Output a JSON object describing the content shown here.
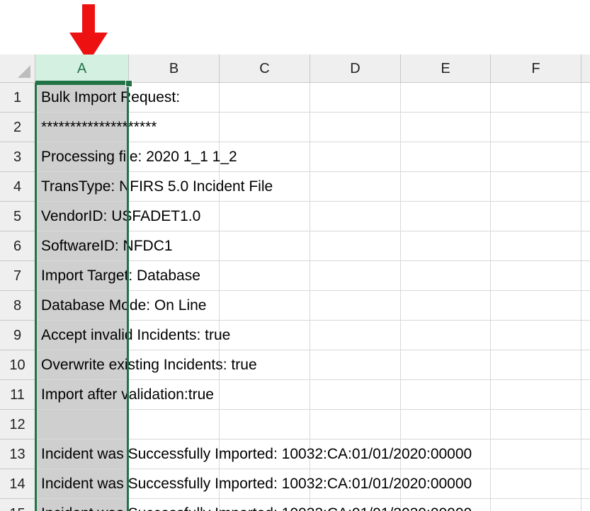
{
  "column_headers": [
    "A",
    "B",
    "C",
    "D",
    "E",
    "F"
  ],
  "selected_column": "A",
  "rows": [
    {
      "num": "1",
      "text": "Bulk Import Request:"
    },
    {
      "num": "2",
      "text": "********************"
    },
    {
      "num": "3",
      "text": "Processing file: 2020 1_1 1_2"
    },
    {
      "num": "4",
      "text": "TransType: NFIRS 5.0 Incident File"
    },
    {
      "num": "5",
      "text": "VendorID: USFADET1.0"
    },
    {
      "num": "6",
      "text": "SoftwareID: NFDC1"
    },
    {
      "num": "7",
      "text": "Import Target: Database"
    },
    {
      "num": "8",
      "text": "Database Mode: On Line"
    },
    {
      "num": "9",
      "text": "Accept invalid Incidents: true"
    },
    {
      "num": "10",
      "text": "Overwrite existing Incidents: true"
    },
    {
      "num": "11",
      "text": "Import after validation:true"
    },
    {
      "num": "12",
      "text": ""
    },
    {
      "num": "13",
      "text": "Incident was Successfully Imported: 10032:CA:01/01/2020:00000"
    },
    {
      "num": "14",
      "text": "Incident was Successfully Imported: 10032:CA:01/01/2020:00000"
    },
    {
      "num": "15",
      "text": "Incident was Successfully Imported: 10032:CA:01/01/2020:00000"
    }
  ],
  "colors": {
    "accent": "#217346",
    "arrow": "#ee1111",
    "selection_fill": "#cfcfcf"
  },
  "icons": {
    "pointer": "red-down-arrow-icon",
    "select_all": "select-all-triangle-icon"
  }
}
